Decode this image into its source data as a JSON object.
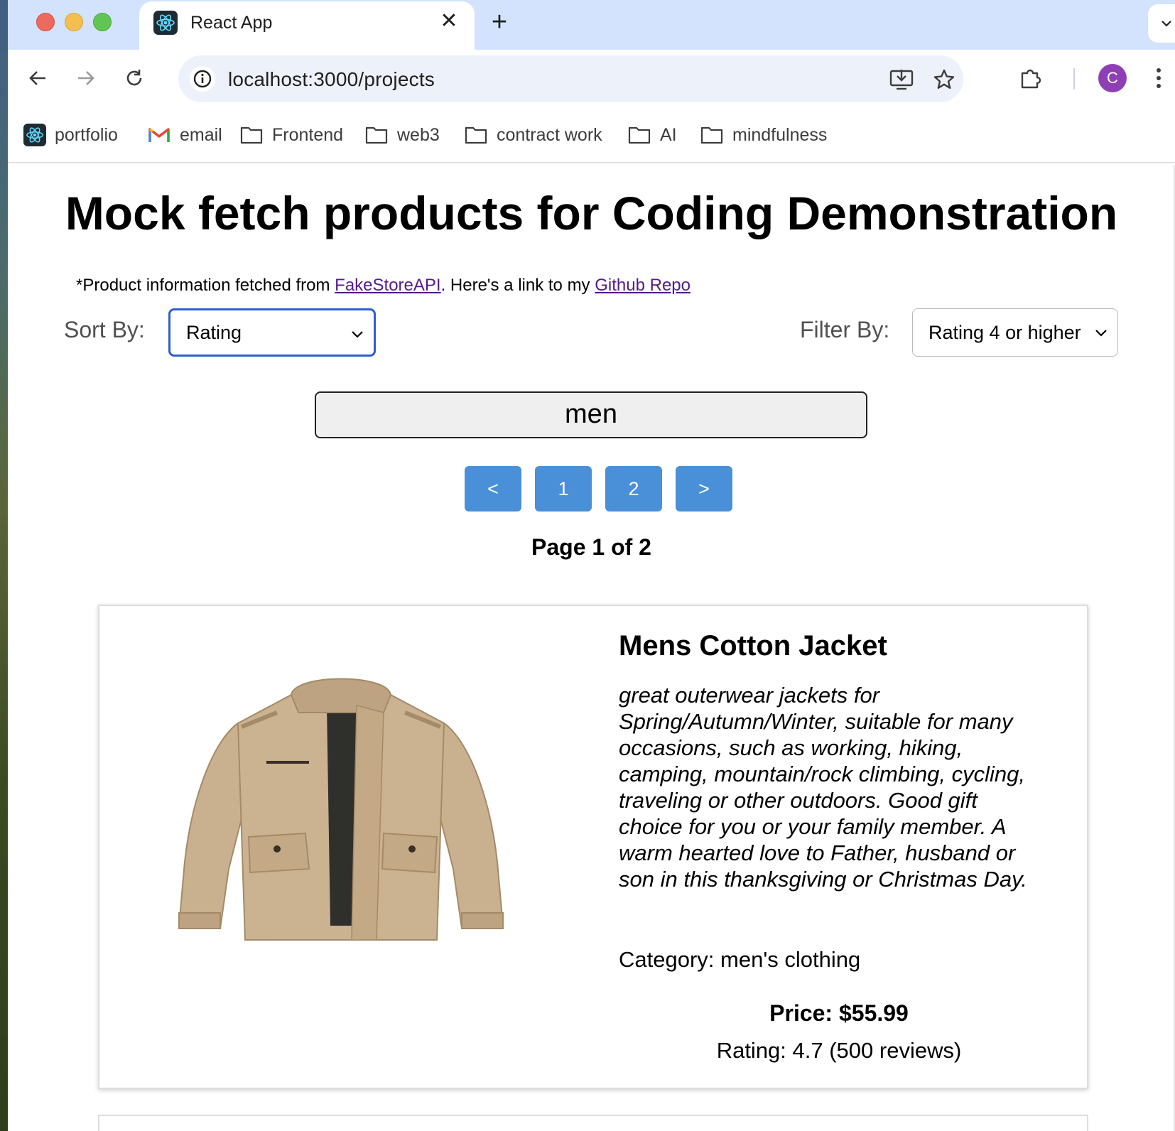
{
  "browser": {
    "tab_title": "React App",
    "url": "localhost:3000/projects",
    "profile_initial": "C",
    "bookmarks": [
      {
        "label": "portfolio",
        "icon": "react-icon"
      },
      {
        "label": "email",
        "icon": "gmail-icon"
      },
      {
        "label": "Frontend",
        "icon": "folder-icon"
      },
      {
        "label": "web3",
        "icon": "folder-icon"
      },
      {
        "label": "contract work",
        "icon": "folder-icon"
      },
      {
        "label": "AI",
        "icon": "folder-icon"
      },
      {
        "label": "mindfulness",
        "icon": "folder-icon"
      }
    ]
  },
  "page": {
    "title": "Mock fetch products for Coding Demonstration",
    "info_prefix": "*Product information fetched from ",
    "info_link1": "FakeStoreAPI",
    "info_middle": ". Here's a link to my ",
    "info_link2": "Github Repo"
  },
  "controls": {
    "sort_label": "Sort By:",
    "sort_value": "Rating",
    "filter_label": "Filter By:",
    "filter_value": "Rating 4 or higher",
    "search_value": "men"
  },
  "pagination": {
    "prev": "<",
    "pages": [
      "1",
      "2"
    ],
    "next": ">",
    "indicator": "Page 1 of 2"
  },
  "product": {
    "name": "Mens Cotton Jacket",
    "description": "great outerwear jackets for Spring/Autumn/Winter, suitable for many occasions, such as working, hiking, camping, mountain/rock climbing, cycling, traveling or other outdoors. Good gift choice for you or your family member. A warm hearted love to Father, husband or son in this thanksgiving or Christmas Day.",
    "category": "Category: men's clothing",
    "price": "Price: $55.99",
    "rating": "Rating: 4.7 (500 reviews)"
  },
  "colors": {
    "tab_strip": "#d3e3fd",
    "pager_button": "#4a90d9",
    "sort_focus": "#2e5fd0",
    "jacket": "#c9b08f",
    "link_visited": "#551a8b"
  }
}
